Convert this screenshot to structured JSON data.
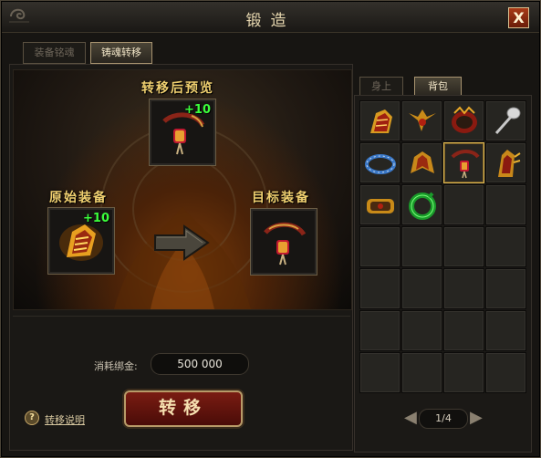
{
  "window": {
    "title": "锻造",
    "close_label": "X"
  },
  "tabs": {
    "soul_inlay": "装备铭魂",
    "soul_transfer": "铸魂转移"
  },
  "scene": {
    "preview_label": "转移后预览",
    "source_label": "原始装备",
    "target_label": "目标装备",
    "preview_enhance": "+10",
    "source_enhance": "+10"
  },
  "cost": {
    "label": "消耗绑金:",
    "value": "500 000"
  },
  "transfer_button": "转移",
  "help": {
    "icon": "?",
    "link": "转移说明"
  },
  "inventory": {
    "tabs": {
      "equipped": "身上",
      "bag": "背包"
    },
    "page": "1/4",
    "items": [
      "gauntlet-gold-red-icon",
      "winged-helm-gold-icon",
      "bracer-red-gold-icon",
      "ladle-silver-icon",
      "bracelet-blue-icon",
      "pauldron-gold-icon",
      "belt-red-pendant-icon",
      "spiked-gauntlet-gold-icon",
      "bracer-dark-gold-icon",
      "ring-green-jade-icon",
      "",
      "",
      "",
      "",
      "",
      "",
      "",
      "",
      "",
      "",
      "",
      "",
      "",
      "",
      "",
      "",
      "",
      ""
    ],
    "selected_index": 6
  },
  "colors": {
    "accent_gold": "#f0d070",
    "enhance_green": "#3cff3c",
    "button_red": "#7a1c12"
  }
}
